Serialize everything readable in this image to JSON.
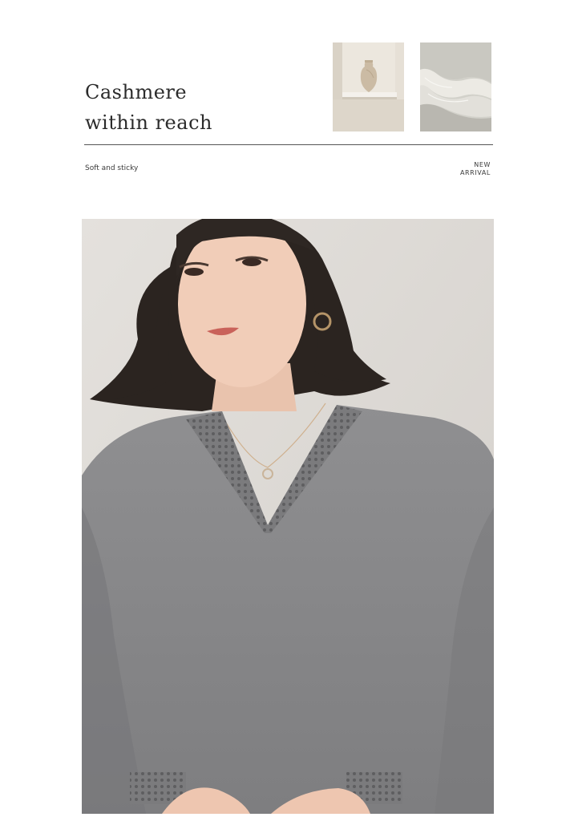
{
  "headline": {
    "line1": "Cashmere",
    "line2": "within reach"
  },
  "tagline": "Soft and sticky",
  "badge": {
    "line1": "NEW",
    "line2": "ARRIVAL"
  },
  "thumbnails": [
    {
      "icon": "vase-niche-photo"
    },
    {
      "icon": "sea-wave-photo"
    }
  ],
  "main_photo": {
    "icon": "model-grey-v-neck-sweater-photo"
  },
  "colors": {
    "background": "#ffffff",
    "sweater": "#8a8a8c",
    "backdrop": "#dedad6",
    "hair": "#2a2420",
    "divider": "#555555"
  }
}
